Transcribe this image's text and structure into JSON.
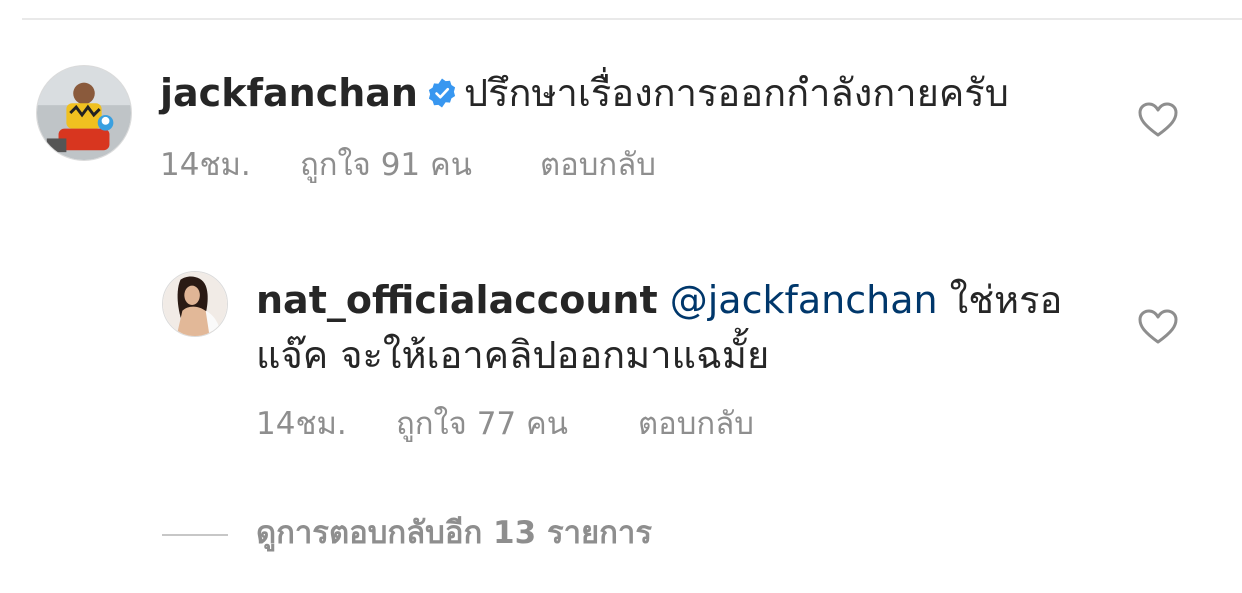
{
  "comments": [
    {
      "username": "jackfanchan",
      "verified": true,
      "text": "ปรึกษาเรื่องการออกกำลังกายครับ",
      "time": "14ชม.",
      "likes": "ถูกใจ 91 คน",
      "reply_label": "ตอบกลับ"
    }
  ],
  "replies": [
    {
      "username": "nat_officialaccount",
      "mention": "@jackfanchan",
      "text_line1": "ใช่หรอ",
      "text_line2": "แจ๊ค จะให้เอาคลิปออกมาแฉมั้ย",
      "time": "14ชม.",
      "likes": "ถูกใจ 77 คน",
      "reply_label": "ตอบกลับ"
    }
  ],
  "view_more_replies": "ดูการตอบกลับอีก 13 รายการ",
  "icons": {
    "verified": "verified-badge-icon",
    "like": "heart-outline-icon"
  },
  "colors": {
    "verified_blue": "#3897f0",
    "mention_blue": "#00376b",
    "text": "#262626",
    "secondary": "#8e8e8e"
  }
}
